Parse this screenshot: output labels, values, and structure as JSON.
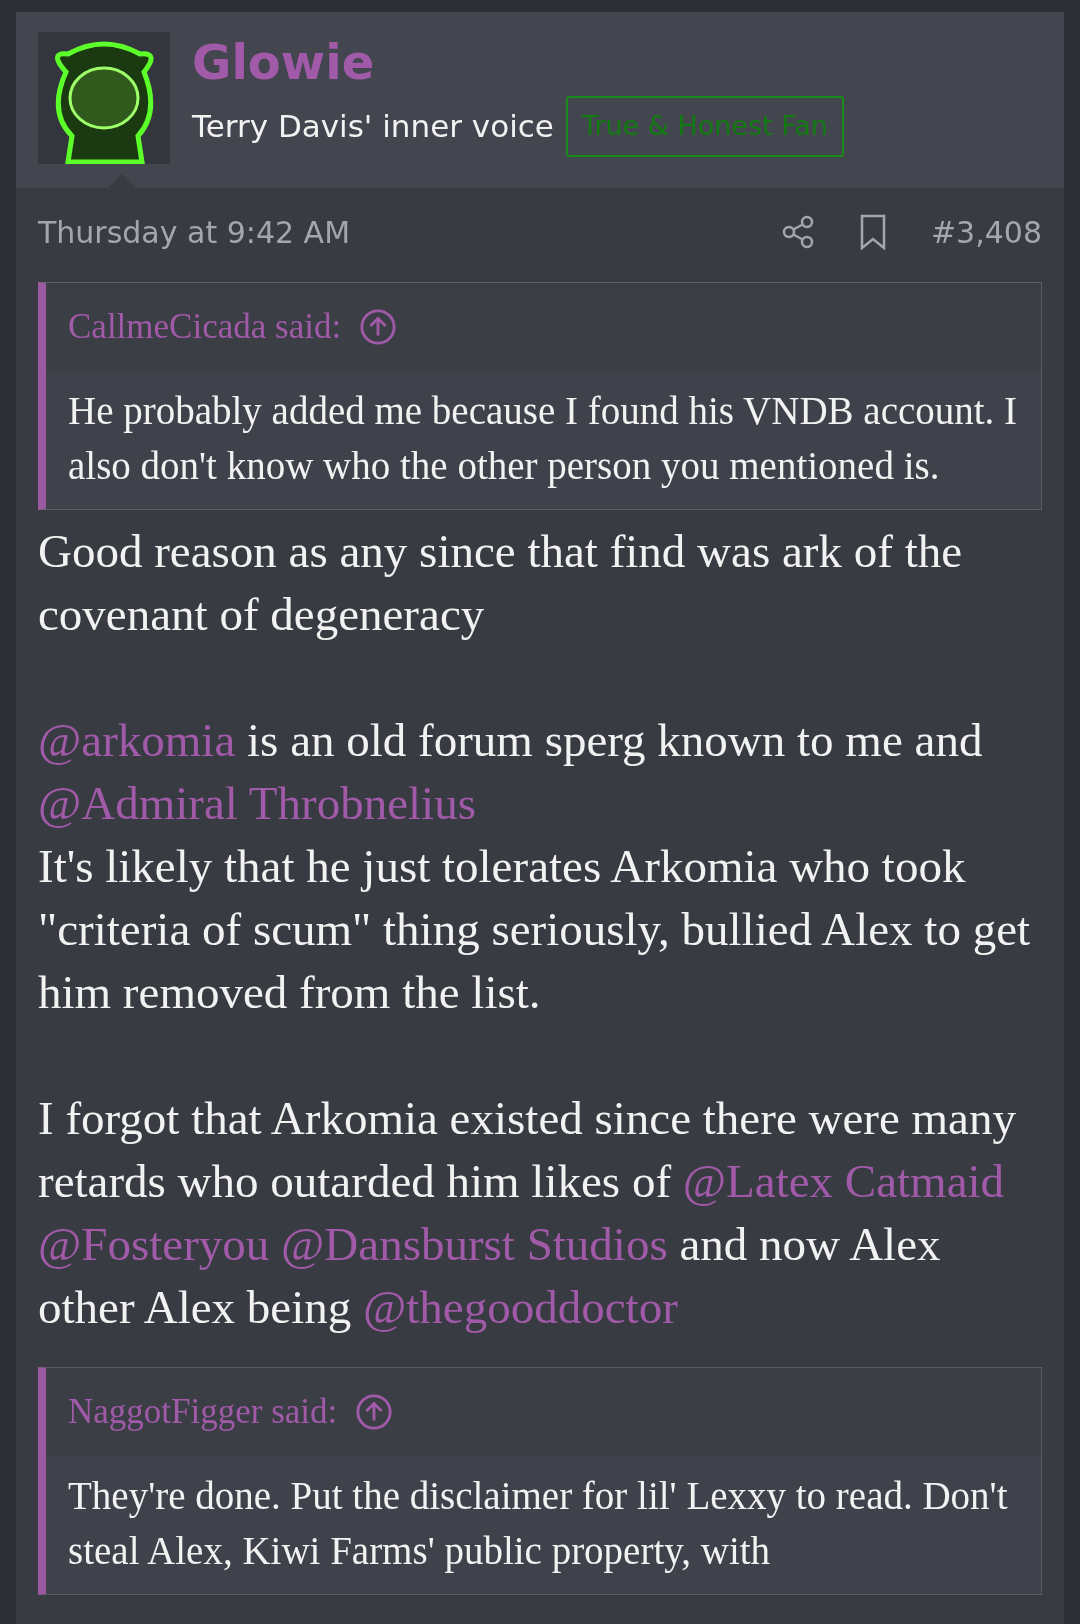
{
  "header": {
    "username": "Glowie",
    "user_title": "Terry Davis' inner voice",
    "banner": "True & Honest Fan"
  },
  "meta": {
    "date": "Thursday at 9:42 AM",
    "post_number": "#3,408"
  },
  "quote": {
    "author": "CallmeCicada said:",
    "text": "He probably added me because I found his VNDB account. I also don't know who the other person you mentioned is."
  },
  "body": [
    {
      "lines": [
        [
          {
            "kind": "text",
            "text": "Good reason as any since that find was ark of the covenant of degeneracy"
          }
        ]
      ]
    },
    {
      "lines": [
        [
          {
            "kind": "mention",
            "text": "@arkomia"
          },
          {
            "kind": "text",
            "text": " is an old forum sperg known to me and "
          },
          {
            "kind": "mention",
            "text": "@Admiral Throbnelius"
          }
        ],
        [
          {
            "kind": "text",
            "text": "It's likely that he just tolerates Arkomia who took \"criteria of scum\" thing seriously, bullied Alex to get him removed from the list."
          }
        ]
      ]
    },
    {
      "lines": [
        [
          {
            "kind": "text",
            "text": "I forgot that Arkomia existed since there were many retards who outarded him likes of "
          },
          {
            "kind": "mention",
            "text": "@Latex Catmaid"
          },
          {
            "kind": "mention",
            "text": "@Fosteryou"
          },
          {
            "kind": "mention",
            "text": "@Dansburst Studios"
          },
          {
            "kind": "text",
            "text": " and now Alex other Alex being "
          },
          {
            "kind": "mention",
            "text": "@thegooddoctor"
          }
        ]
      ]
    }
  ],
  "quote_2": {
    "author": "NaggotFigger said:",
    "text": "They're done. Put the disclaimer for lil' Lexxy to read. Don't steal Alex, Kiwi Farms' public property, with"
  }
}
